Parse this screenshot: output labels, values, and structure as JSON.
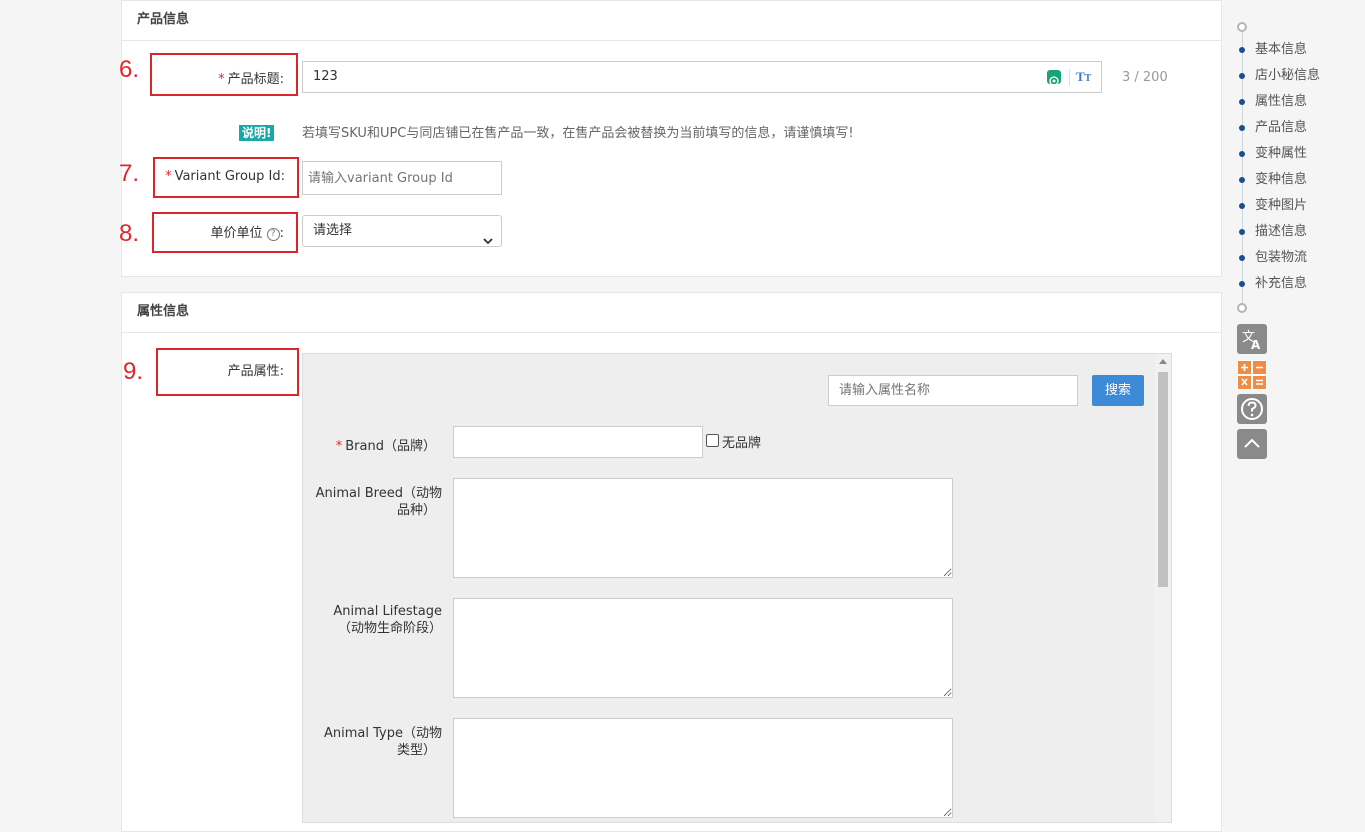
{
  "product_section": {
    "title": "产品信息",
    "step6": "6.",
    "step7": "7.",
    "step8": "8.",
    "title_field": {
      "required": "*",
      "label": "产品标题:",
      "value": "123",
      "counter": "3 / 200"
    },
    "note": {
      "badge": "说明!",
      "text": "若填写SKU和UPC与同店铺已在售产品一致，在售产品会被替换为当前填写的信息，请谨慎填写!"
    },
    "variant_group": {
      "required": "*",
      "label": "Variant Group Id:",
      "placeholder": "请输入variant Group Id"
    },
    "unit_price": {
      "label": "单价单位",
      "colon": ":",
      "selected": "请选择"
    }
  },
  "attribute_section": {
    "title": "属性信息",
    "step9": "9.",
    "label": "产品属性:",
    "search_placeholder": "请输入属性名称",
    "search_button": "搜索",
    "brand": {
      "required": "*",
      "label": "Brand（品牌）",
      "no_brand": "无品牌"
    },
    "animal_breed": {
      "line1": "Animal Breed（动物",
      "line2": "品种）"
    },
    "animal_lifestage": {
      "line1": "Animal Lifestage",
      "line2": "（动物生命阶段）"
    },
    "animal_type": {
      "line1": "Animal Type（动物",
      "line2": "类型）"
    }
  },
  "side_nav": {
    "items": [
      "基本信息",
      "店小秘信息",
      "属性信息",
      "产品信息",
      "变种属性",
      "变种信息",
      "变种图片",
      "描述信息",
      "包装物流",
      "补充信息"
    ]
  },
  "tools": [
    "translate-icon",
    "calculator-icon",
    "help-icon",
    "back-to-top-icon"
  ],
  "colors": {
    "required": "#e0262c",
    "search_button": "#3d8ad6",
    "badge": "#17a8a8",
    "nav_dot": "#1a4f8c",
    "annotation": "#d9262c"
  }
}
